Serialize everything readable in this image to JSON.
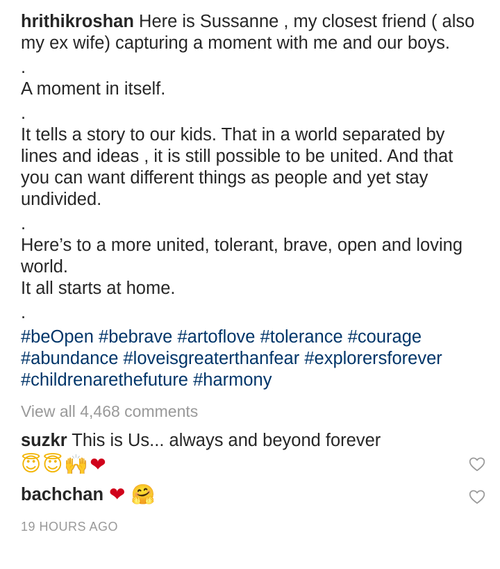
{
  "post": {
    "username": "hrithikroshan",
    "caption_line1": "Here is Sussanne , my closest friend ( also my ex wife) capturing a moment with me and our boys.",
    "dot": ".",
    "caption_line2": "A moment in itself.",
    "caption_line3": "It tells a story to our kids. That in a world separated by lines and ideas , it is still possible to be united. And that you can want different things as people and yet stay undivided.",
    "caption_line4a": "Here’s to a more united, tolerant, brave, open and loving world.",
    "caption_line4b": "It all starts at home.",
    "hashtags": [
      "#beOpen",
      "#bebrave",
      "#artoflove",
      "#tolerance",
      "#courage",
      "#abundance",
      "#loveisgreaterthanfear",
      "#explorersforever",
      "#childrenarethefuture",
      "#harmony"
    ]
  },
  "comments_link": "View all 4,468 comments",
  "comments": [
    {
      "username": "suzkr",
      "text": "This is Us... always and beyond forever",
      "emojis": [
        "😇",
        "😇",
        "🙌",
        "❤"
      ]
    },
    {
      "username": "bachchan",
      "text": "",
      "emojis": [
        "❤",
        "🤗"
      ]
    }
  ],
  "timestamp": "19 HOURS AGO",
  "icons": {
    "like": "heart-outline-icon"
  },
  "colors": {
    "text": "#262626",
    "hashtag": "#003569",
    "muted": "#999999"
  }
}
